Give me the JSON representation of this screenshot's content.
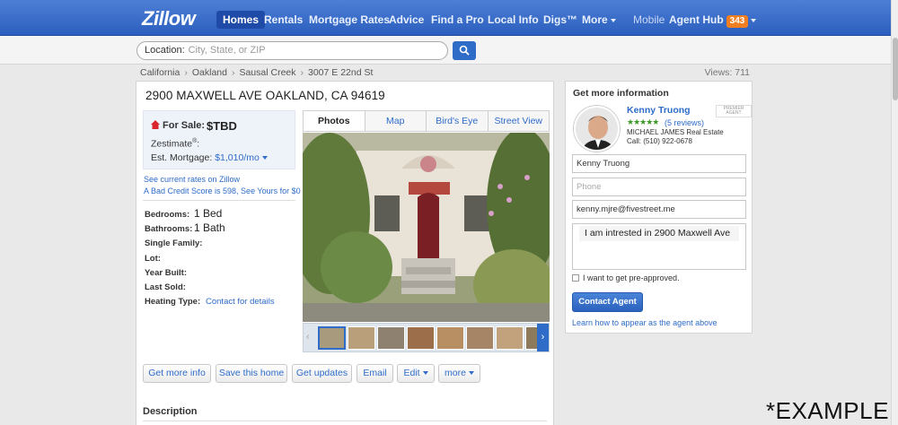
{
  "nav": {
    "logo": "Zillow",
    "items": [
      {
        "label": "Homes",
        "active": true
      },
      {
        "label": "Rentals"
      },
      {
        "label": "Mortgage Rates"
      },
      {
        "label": "Advice"
      },
      {
        "label": "Find a Pro"
      },
      {
        "label": "Local Info"
      },
      {
        "label": "Digs™"
      },
      {
        "label": "More"
      }
    ],
    "mobile": "Mobile",
    "agent_hub": "Agent Hub",
    "agent_hub_count": "343"
  },
  "search": {
    "label": "Location:",
    "placeholder": "City, State, or ZIP",
    "button_icon": "search-icon"
  },
  "breadcrumb": [
    "California",
    "Oakland",
    "Sausal Creek",
    "3007 E 22nd St"
  ],
  "views": "Views: 711",
  "listing": {
    "address": "2900 MAXWELL AVE OAKLAND, CA 94619",
    "for_sale_label": "For Sale:",
    "price": "$TBD",
    "zestimate_label": "Zestimate",
    "zestimate_sup": "®",
    "zestimate_colon": ":",
    "est_mortgage_label": "Est. Mortgage:",
    "est_mortgage_value": "$1,010/mo",
    "rates_link": "See current rates on Zillow",
    "credit_link": "A Bad Credit Score is 598, See Yours for $0",
    "facts": [
      {
        "label": "Bedrooms:",
        "value": "1 Bed"
      },
      {
        "label": "Bathrooms:",
        "value": "1 Bath"
      },
      {
        "label": "Single Family:",
        "value": ""
      },
      {
        "label": "Lot:",
        "value": ""
      },
      {
        "label": "Year Built:",
        "value": ""
      },
      {
        "label": "Last Sold:",
        "value": ""
      },
      {
        "label": "Heating Type:",
        "value": "",
        "link": "Contact for details"
      }
    ],
    "photo_tabs": [
      "Photos",
      "Map",
      "Bird's Eye",
      "Street View"
    ],
    "actions": [
      "Get more info",
      "Save this home",
      "Get updates",
      "Email",
      "Edit",
      "more"
    ],
    "description_heading": "Description"
  },
  "sidebar": {
    "title": "Get more information",
    "agent_name": "Kenny Truong",
    "premier_badge": "PREMIER AGENT",
    "rating_stars": "★★★★★",
    "reviews": "(5 reviews)",
    "firm": "MICHAEL JAMES Real Estate",
    "phone": "Call: (510) 922-0678",
    "name_value": "Kenny Truong",
    "phone_placeholder": "Phone",
    "email_value": "kenny.mjre@fivestreet.me",
    "message_value": "I am intrested in 2900 Maxwell Ave",
    "preapproved_label": "I want to get pre-approved.",
    "contact_button": "Contact Agent",
    "learn_link": "Learn how to appear as the agent above"
  },
  "watermark": "*EXAMPLE",
  "colors": {
    "brand_blue": "#2e6cc8",
    "nav_blue": "#3a6fcb",
    "badge_orange": "#f17e21",
    "star_green": "#3c9a29"
  }
}
